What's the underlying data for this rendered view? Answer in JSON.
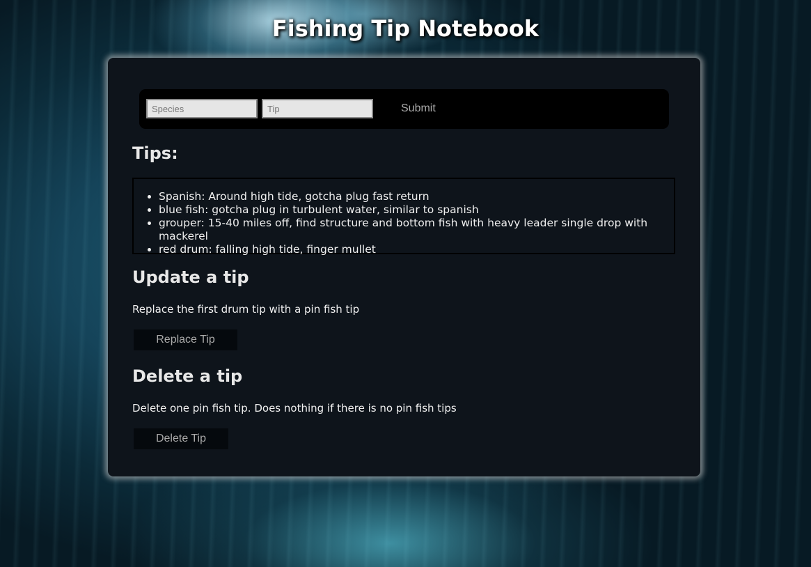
{
  "page": {
    "title": "Fishing Tip Notebook"
  },
  "form": {
    "species_placeholder": "Species",
    "tip_placeholder": "Tip",
    "submit_label": "Submit"
  },
  "tips": {
    "heading": "Tips:",
    "items": [
      "Spanish: Around high tide, gotcha plug fast return",
      "blue fish: gotcha plug in turbulent water, similar to spanish",
      "grouper: 15-40 miles off, find structure and bottom fish with heavy leader single drop with mackerel",
      "red drum: falling high tide, finger mullet"
    ]
  },
  "update": {
    "heading": "Update a tip",
    "description": "Replace the first drum tip with a pin fish tip",
    "button_label": "Replace Tip"
  },
  "delete": {
    "heading": "Delete a tip",
    "description": "Delete one pin fish tip. Does nothing if there is no pin fish tips",
    "button_label": "Delete Tip"
  },
  "colors": {
    "card_bg": "#0e141b",
    "form_bar_bg": "#000000",
    "button_bg": "#05090d",
    "text": "#e6e6e6"
  }
}
